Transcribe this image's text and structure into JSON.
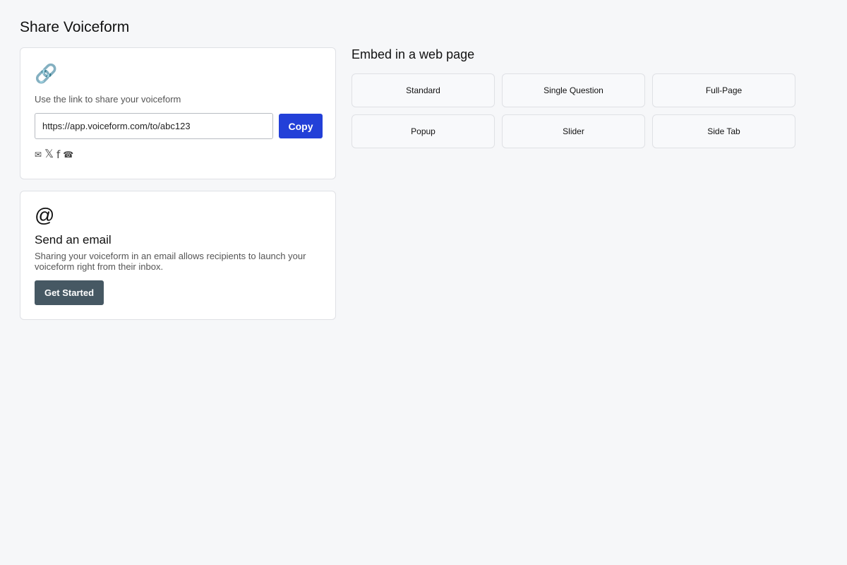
{
  "page": {
    "title": "Share Voiceform"
  },
  "link_card": {
    "icon": "link-icon",
    "icon_glyph": "🔗",
    "hint": "Use the link to share your voiceform",
    "url_value": "https://app.voiceform.com/to/abc123",
    "copy_label": "Copy",
    "copy_color": "#2340d8",
    "social": [
      {
        "name": "email-share-icon",
        "glyph": "✉"
      },
      {
        "name": "x-share-icon",
        "glyph": "𝕏"
      },
      {
        "name": "facebook-share-icon",
        "glyph": "f"
      },
      {
        "name": "phone-share-icon",
        "glyph": "☎"
      }
    ]
  },
  "email_card": {
    "icon": "at-icon",
    "icon_glyph": "@",
    "title": "Send an email",
    "description": "Sharing your voiceform in an email allows recipients to launch your voiceform right from their inbox.",
    "button_label": "Get Started",
    "button_color": "#465863"
  },
  "embed": {
    "title": "Embed in a web page",
    "options": [
      {
        "label": "Standard"
      },
      {
        "label": "Single Question"
      },
      {
        "label": "Full-Page"
      },
      {
        "label": "Popup"
      },
      {
        "label": "Slider"
      },
      {
        "label": "Side Tab"
      }
    ]
  }
}
